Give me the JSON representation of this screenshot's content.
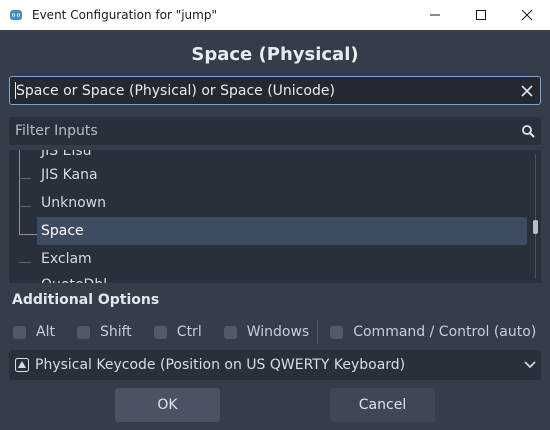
{
  "window": {
    "title": "Event Configuration for \"jump\"",
    "minimize": "—",
    "maximize": "□",
    "close": "✕"
  },
  "heading": "Space (Physical)",
  "event_field": {
    "value": "Space or Space (Physical) or Space (Unicode)"
  },
  "filter": {
    "placeholder": "Filter Inputs"
  },
  "tree": {
    "items": [
      {
        "label": "JIS Eisu",
        "selected": false
      },
      {
        "label": "JIS Kana",
        "selected": false
      },
      {
        "label": "Unknown",
        "selected": false
      },
      {
        "label": "Space",
        "selected": true
      },
      {
        "label": "Exclam",
        "selected": false
      },
      {
        "label": "QuoteDbl",
        "selected": false
      }
    ]
  },
  "additional_options": {
    "label": "Additional Options",
    "modifiers": [
      {
        "label": "Alt",
        "checked": false
      },
      {
        "label": "Shift",
        "checked": false
      },
      {
        "label": "Ctrl",
        "checked": false
      },
      {
        "label": "Windows",
        "checked": false
      }
    ],
    "command": {
      "label": "Command / Control (auto)",
      "checked": false
    }
  },
  "keycode_dropdown": {
    "value": "Physical Keycode (Position on US QWERTY Keyboard)",
    "icon": "keyboard-icon"
  },
  "buttons": {
    "ok": "OK",
    "cancel": "Cancel"
  },
  "colors": {
    "background": "#363d4a",
    "field": "#2a303b",
    "accent_border": "#7aa6d8",
    "selection": "#3e4c62"
  }
}
